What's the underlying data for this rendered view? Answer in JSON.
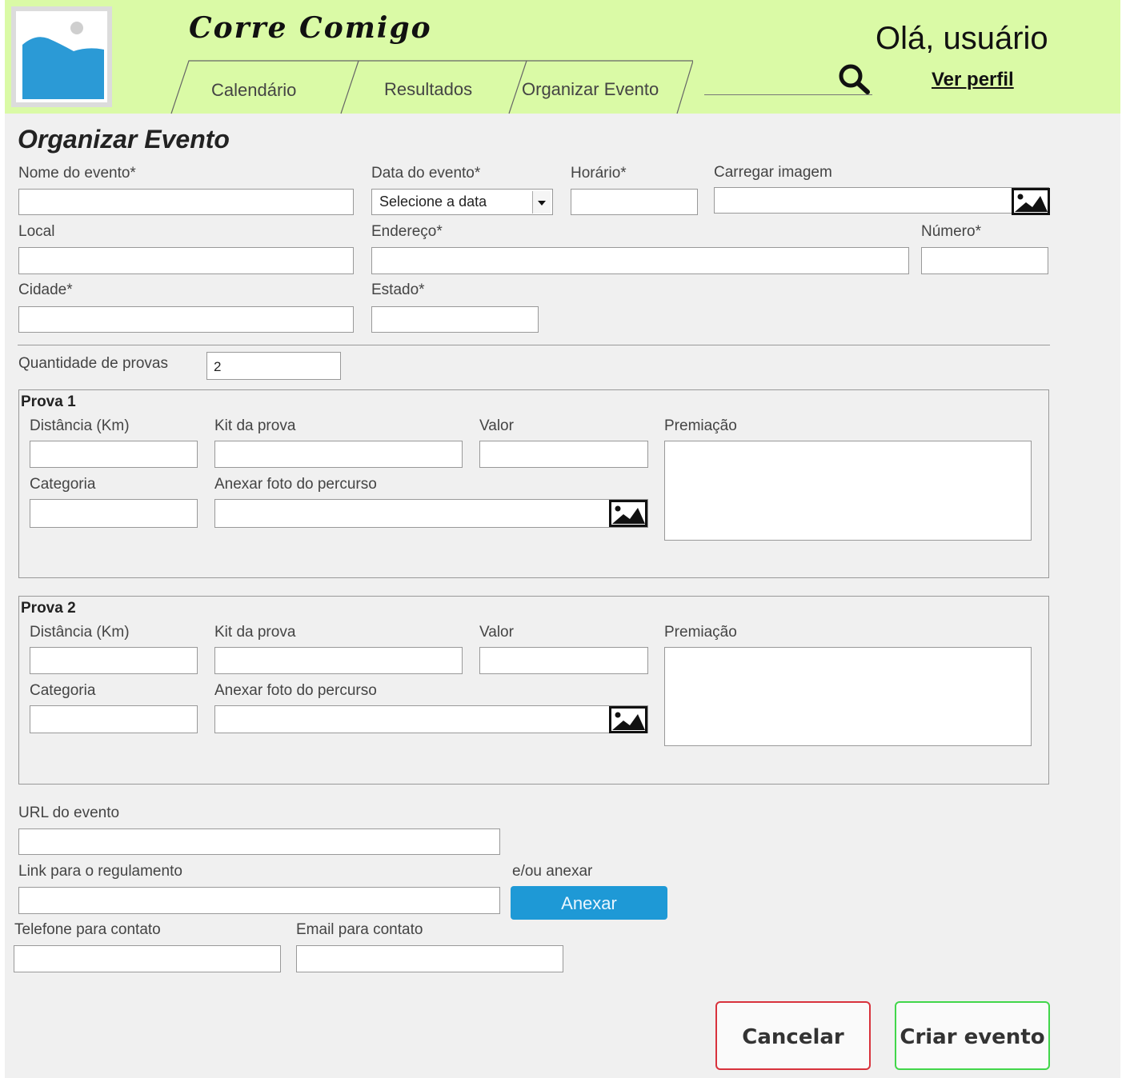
{
  "header": {
    "brand": "Corre Comigo",
    "tabs": [
      "Calendário",
      "Resultados",
      "Organizar Evento"
    ],
    "greeting": "Olá, usuário",
    "profile_link": "Ver perfil"
  },
  "form": {
    "title": "Organizar Evento",
    "event_name_label": "Nome do evento*",
    "event_date_label": "Data do evento*",
    "event_date_select": "Selecione a data",
    "time_label": "Horário*",
    "upload_image_label": "Carregar imagem",
    "location_label": "Local",
    "address_label": "Endereço*",
    "number_label": "Número*",
    "city_label": "Cidade*",
    "state_label": "Estado*",
    "race_count_label": "Quantidade de provas",
    "race_count_value": "2",
    "races": [
      {
        "title": "Prova 1",
        "distance_label": "Distância (Km)",
        "kit_label": "Kit da prova",
        "value_label": "Valor",
        "prize_label": "Premiação",
        "category_label": "Categoria",
        "route_photo_label": "Anexar foto do percurso"
      },
      {
        "title": "Prova 2",
        "distance_label": "Distância (Km)",
        "kit_label": "Kit da prova",
        "value_label": "Valor",
        "prize_label": "Premiação",
        "category_label": "Categoria",
        "route_photo_label": "Anexar foto do percurso"
      }
    ],
    "event_url_label": "URL do evento",
    "rules_link_label": "Link para o regulamento",
    "or_attach_label": "e/ou anexar",
    "attach_button": "Anexar",
    "phone_label": "Telefone para contato",
    "email_label": "Email para contato"
  },
  "actions": {
    "cancel": "Cancelar",
    "create": "Criar evento"
  },
  "colors": {
    "header_bg": "#dafaa6",
    "page_bg": "#f0f0f0",
    "attach_button": "#1e99d6",
    "cancel_border": "#d8323c",
    "create_border": "#41d64a"
  }
}
